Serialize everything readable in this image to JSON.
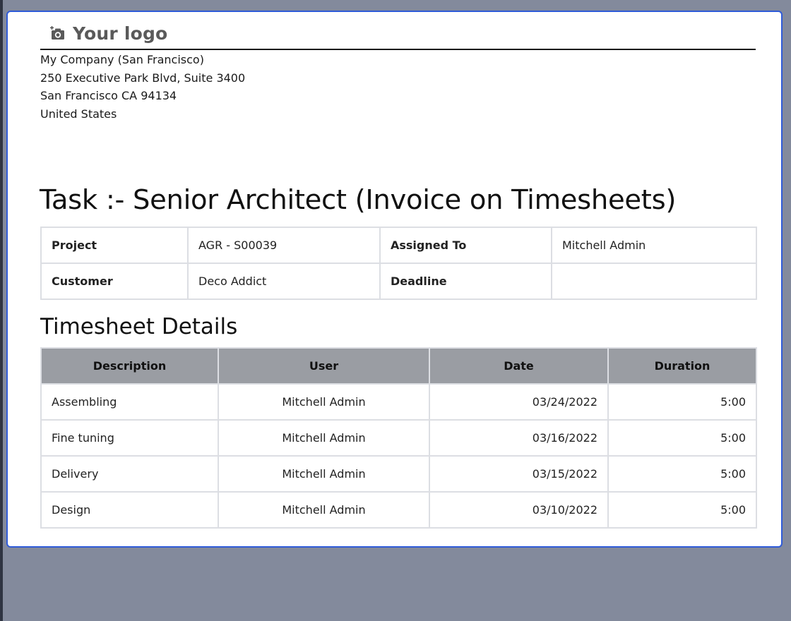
{
  "logo": {
    "text": "Your logo",
    "icon": "camera-icon"
  },
  "company": {
    "name": "My Company (San Francisco)",
    "street": "250 Executive Park Blvd, Suite 3400",
    "city": "San Francisco CA 94134",
    "country": "United States"
  },
  "task": {
    "title": "Task :- Senior Architect (Invoice on Timesheets)",
    "project_label": "Project",
    "project_value": "AGR - S00039",
    "assigned_label": "Assigned To",
    "assigned_value": "Mitchell Admin",
    "customer_label": "Customer",
    "customer_value": "Deco Addict",
    "deadline_label": "Deadline",
    "deadline_value": ""
  },
  "timesheet": {
    "title": "Timesheet Details",
    "columns": [
      "Description",
      "User",
      "Date",
      "Duration"
    ],
    "rows": [
      {
        "description": "Assembling",
        "user": "Mitchell Admin",
        "date": "03/24/2022",
        "duration": "5:00"
      },
      {
        "description": "Fine tuning",
        "user": "Mitchell Admin",
        "date": "03/16/2022",
        "duration": "5:00"
      },
      {
        "description": "Delivery",
        "user": "Mitchell Admin",
        "date": "03/15/2022",
        "duration": "5:00"
      },
      {
        "description": "Design",
        "user": "Mitchell Admin",
        "date": "03/10/2022",
        "duration": "5:00"
      }
    ]
  },
  "colors": {
    "sheet_border": "#2f5bd8",
    "table_header_bg": "#9a9da3",
    "page_bg": "#838a9c"
  }
}
